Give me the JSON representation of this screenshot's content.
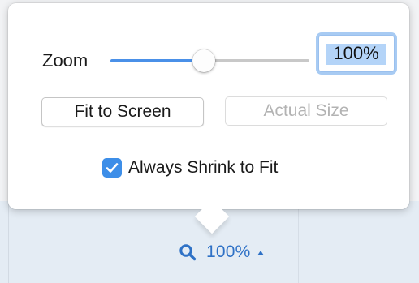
{
  "popover": {
    "zoom_label": "Zoom",
    "zoom_slider_level_percent": 47,
    "zoom_field_value": "100%",
    "fit_to_screen_label": "Fit to Screen",
    "actual_size_label": "Actual Size",
    "always_shrink_label": "Always Shrink to Fit",
    "always_shrink_checked": true
  },
  "status_bar": {
    "zoom_value": "100%",
    "icons": [
      "magnifier-icon",
      "caret-up-icon"
    ]
  },
  "colors": {
    "accent": "#2e71c6",
    "slider_fill": "#4a90e8",
    "checkbox": "#3d8ee8",
    "status_bar_bg": "#e4ecf4",
    "disabled_text": "#b3b3b3"
  }
}
